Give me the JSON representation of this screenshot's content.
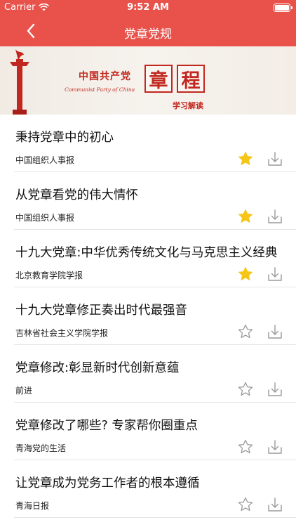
{
  "status_bar": {
    "carrier": "Carrier",
    "time": "9:52 AM"
  },
  "nav": {
    "title": "党章党规",
    "back_icon": "chevron-left-icon"
  },
  "banner": {
    "cn_name": "中国共产党",
    "en_name": "Communist Party of China",
    "char1": "章",
    "char2": "程",
    "subtitle": "学习解读"
  },
  "colors": {
    "brand_red": "#e8524b",
    "star_gold": "#f5c518",
    "icon_gray": "#9a9a9a"
  },
  "articles": [
    {
      "title": "秉持党章中的初心",
      "source": "中国组织人事报",
      "starred": true
    },
    {
      "title": "从党章看党的伟大情怀",
      "source": "中国组织人事报",
      "starred": true
    },
    {
      "title": "十九大党章:中华优秀传统文化与马克思主义经典",
      "source": "北京教育学院学报",
      "starred": true
    },
    {
      "title": "十九大党章修正奏出时代最强音",
      "source": "吉林省社会主义学院学报",
      "starred": false
    },
    {
      "title": "党章修改:彰显新时代创新意蕴",
      "source": "前进",
      "starred": false
    },
    {
      "title": "党章修改了哪些? 专家帮你圈重点",
      "source": "青海党的生活",
      "starred": false
    },
    {
      "title": "让党章成为党务工作者的根本遵循",
      "source": "青海日报",
      "starred": false
    }
  ]
}
